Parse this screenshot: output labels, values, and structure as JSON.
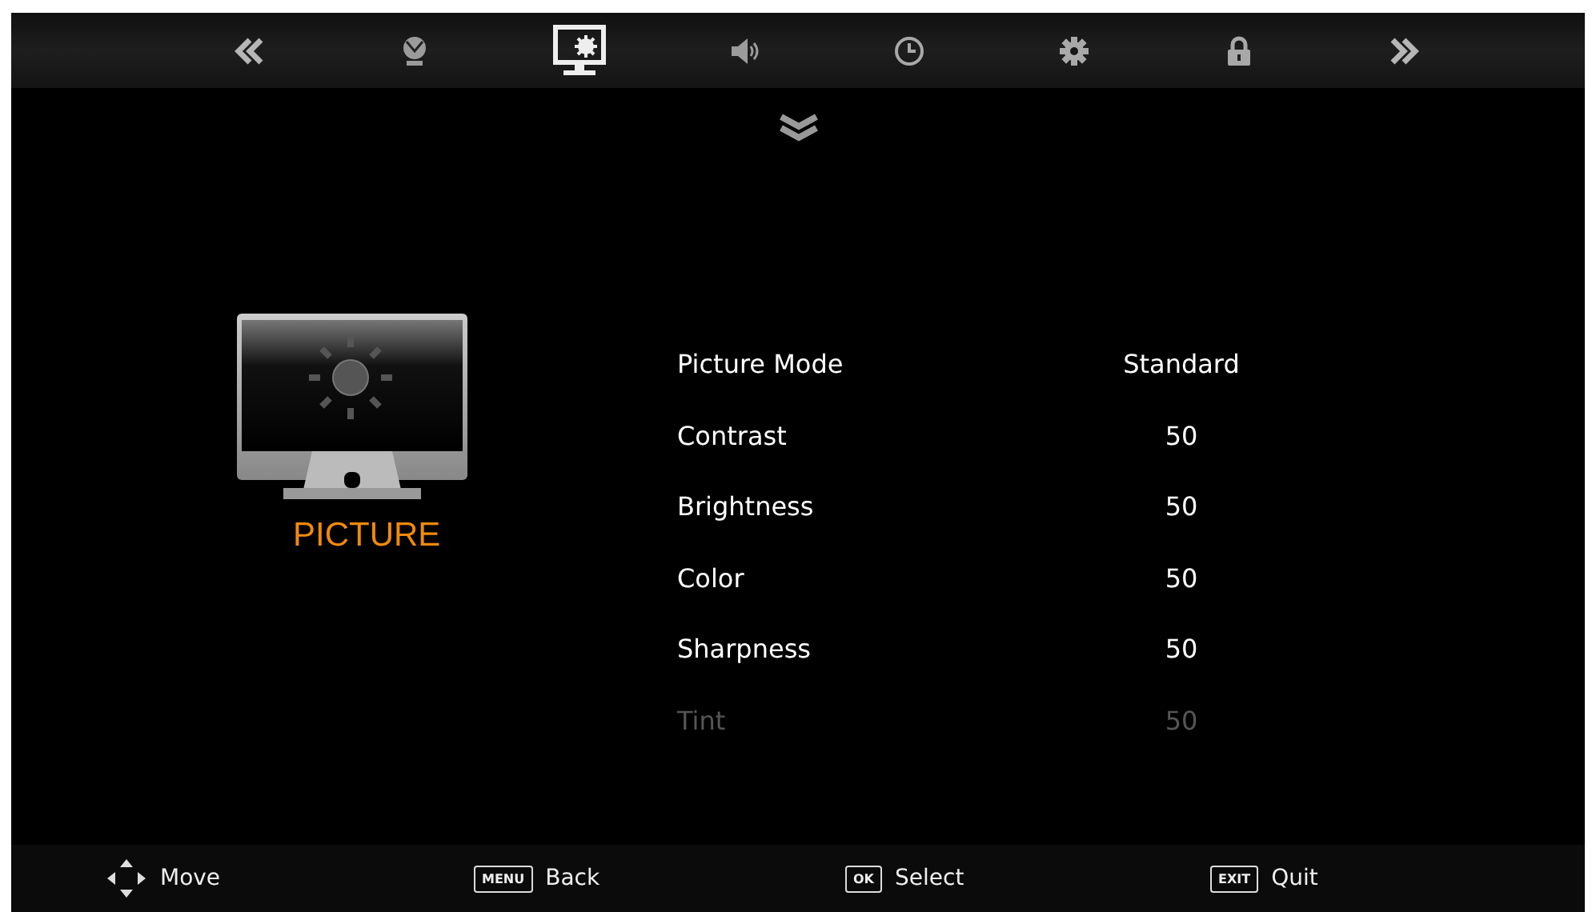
{
  "tabs": [
    {
      "kind": "prev",
      "selected": false
    },
    {
      "kind": "channel",
      "selected": false
    },
    {
      "kind": "picture",
      "selected": true
    },
    {
      "kind": "sound",
      "selected": false
    },
    {
      "kind": "time",
      "selected": false
    },
    {
      "kind": "setup",
      "selected": false
    },
    {
      "kind": "lock",
      "selected": false
    },
    {
      "kind": "next",
      "selected": false
    }
  ],
  "section": {
    "title": "PICTURE"
  },
  "menu": [
    {
      "label": "Picture Mode",
      "value": "Standard",
      "disabled": false
    },
    {
      "label": "Contrast",
      "value": "50",
      "disabled": false
    },
    {
      "label": "Brightness",
      "value": "50",
      "disabled": false
    },
    {
      "label": "Color",
      "value": "50",
      "disabled": false
    },
    {
      "label": "Sharpness",
      "value": "50",
      "disabled": false
    },
    {
      "label": "Tint",
      "value": "50",
      "disabled": true
    }
  ],
  "footer": [
    {
      "kind": "arrows",
      "label": "Move"
    },
    {
      "kind": "key",
      "key": "MENU",
      "label": "Back"
    },
    {
      "kind": "key",
      "key": "OK",
      "label": "Select"
    },
    {
      "kind": "key",
      "key": "EXIT",
      "label": "Quit"
    }
  ]
}
